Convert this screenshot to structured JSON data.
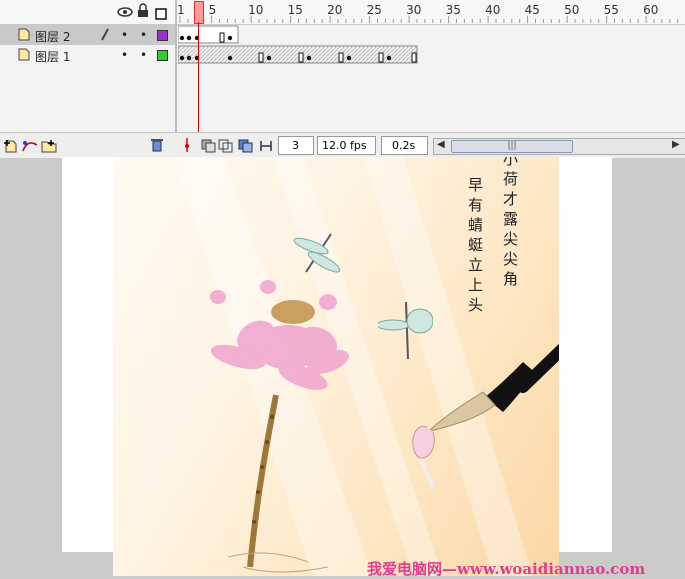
{
  "timeline": {
    "ruler_ticks": [
      "1",
      "5",
      "10",
      "15",
      "20",
      "25",
      "30",
      "35",
      "40",
      "45",
      "50",
      "55",
      "60"
    ],
    "layers": [
      {
        "name": "图层 2",
        "selected": true,
        "color": "#9933cc"
      },
      {
        "name": "图层 1",
        "selected": false,
        "color": "#33cc33"
      }
    ],
    "status": {
      "current_frame": "3",
      "frame_rate": "12.0 fps",
      "elapsed": "0.2s"
    },
    "scrollbar_grip": "|||"
  },
  "icons": {
    "header": [
      "eye-icon",
      "lock-icon",
      "outline-icon"
    ],
    "bottom_left": [
      "insert-layer-icon",
      "add-motion-guide-icon",
      "insert-folder-icon",
      "trash-icon"
    ],
    "bottom_tools": [
      "center-frame-icon",
      "onion-skin-icon",
      "onion-skin-outlines-icon",
      "edit-multiple-frames-icon",
      "modify-onion-markers-icon"
    ]
  },
  "artwork": {
    "poem_right_column": "小荷才露尖尖角",
    "poem_left_column": "早有蜻蜓立上头",
    "watermark": "我爱电脑网—www.woaidiannao.com"
  }
}
